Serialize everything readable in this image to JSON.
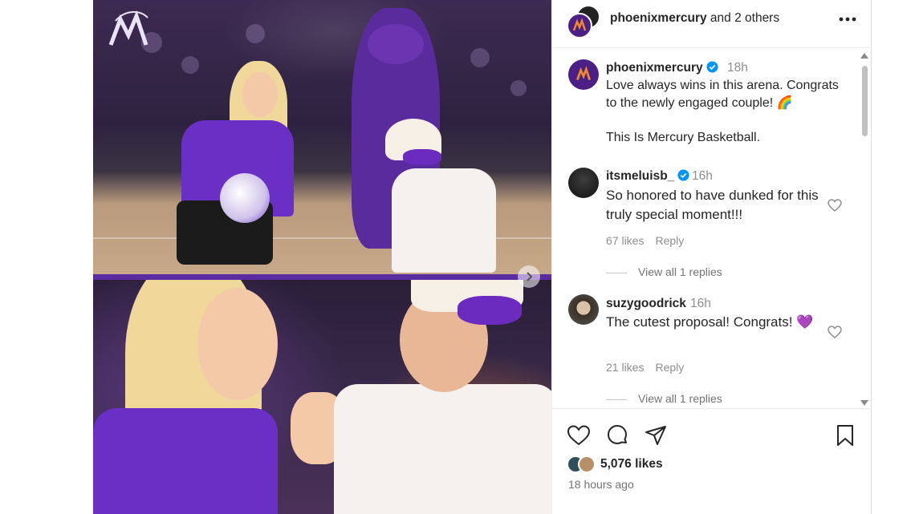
{
  "post": {
    "header": {
      "author": "phoenixmercury",
      "others": "and 2 others"
    },
    "media": {
      "carousel_next_icon": "chevron-right-icon"
    },
    "caption": {
      "username": "phoenixmercury",
      "time": "18h",
      "text": "Love always wins in this arena. Congrats to the newly engaged couple! 🌈\n\nThis Is Mercury Basketball."
    },
    "comments": [
      {
        "username": "itsmeluisb_",
        "verified": true,
        "time": "16h",
        "text": "So honored to have dunked for this truly special moment!!!",
        "likes": "67 likes",
        "reply": "Reply",
        "view_replies": "View all 1 replies"
      },
      {
        "username": "suzygoodrick",
        "verified": false,
        "time": "16h",
        "text": "The cutest proposal! Congrats! 💜",
        "likes": "21 likes",
        "reply": "Reply",
        "view_replies": "View all 1 replies"
      }
    ],
    "likes_count": "5,076 likes",
    "posted_ago": "18 hours ago"
  },
  "colors": {
    "brand_purple": "#5a2ca0",
    "verified_blue": "#0095f6",
    "secondary_text": "#8e8e8e"
  }
}
